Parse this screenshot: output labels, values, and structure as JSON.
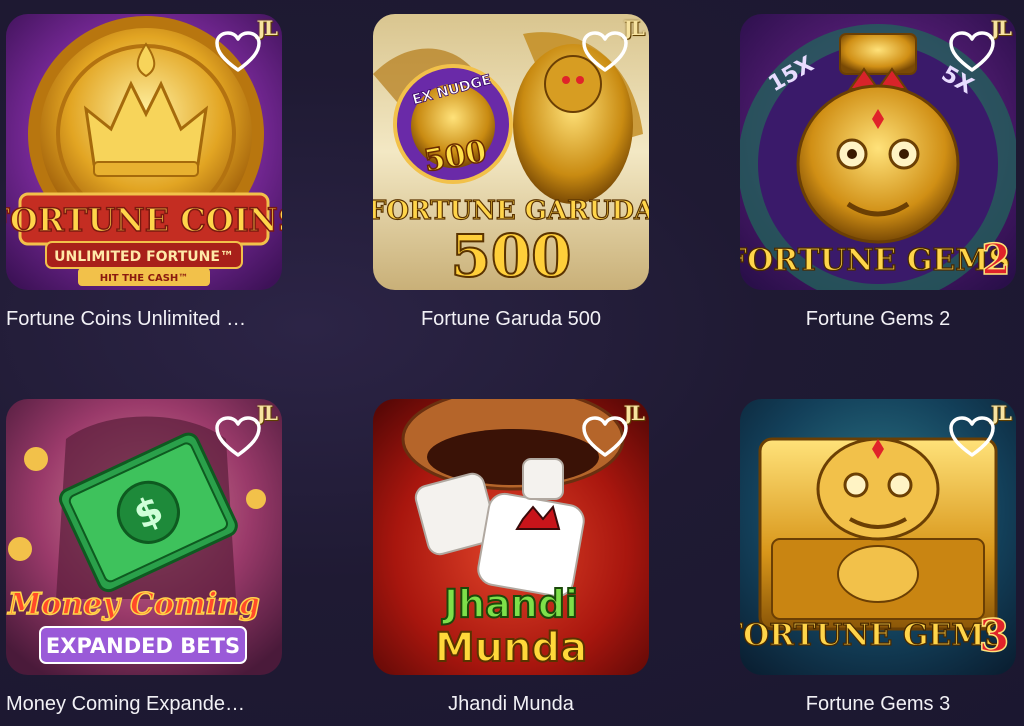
{
  "games": [
    {
      "title": "Fortune Coins Unlimited …",
      "badge": "JL",
      "logo_line1": "FORTUNE COINS",
      "logo_line2": "UNLIMITED FORTUNE™",
      "logo_line3": "HIT THE CASH™",
      "favorite_icon": "heart-outline-icon"
    },
    {
      "title": "Fortune Garuda 500",
      "badge": "JL",
      "logo_line1": "FORTUNE GARUDA",
      "logo_line2": "500",
      "logo_line3": "EX NUDGE",
      "logo_line4": "500",
      "favorite_icon": "heart-outline-icon"
    },
    {
      "title": "Fortune Gems 2",
      "badge": "JL",
      "logo_line1": "FORTUNE GEMS",
      "logo_line2": "2",
      "logo_line3": "15X",
      "logo_line4": "5X",
      "favorite_icon": "heart-outline-icon"
    },
    {
      "title": "Money Coming Expande…",
      "badge": "JL",
      "logo_line1": "Money Coming",
      "logo_line2": "EXPANDED BETS",
      "favorite_icon": "heart-outline-icon"
    },
    {
      "title": "Jhandi Munda",
      "badge": "JL",
      "logo_line1": "Jhandi",
      "logo_line2": "Munda",
      "favorite_icon": "heart-outline-icon"
    },
    {
      "title": "Fortune Gems 3",
      "badge": "JL",
      "logo_line1": "FORTUNE GEMS",
      "logo_line2": "3",
      "favorite_icon": "heart-outline-icon"
    }
  ],
  "colors": {
    "background": "#1f1a33",
    "title_text": "#f2f1f6",
    "heart_stroke": "#ffffff"
  }
}
